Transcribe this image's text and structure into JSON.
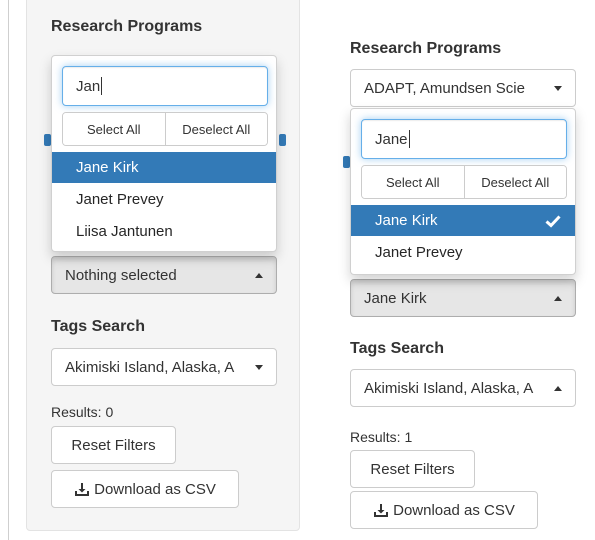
{
  "left_panel": {
    "research_programs_label": "Research Programs",
    "search_value": "Jan",
    "select_all_label": "Select All",
    "deselect_all_label": "Deselect All",
    "options": [
      {
        "label": "Jane Kirk",
        "active": true
      },
      {
        "label": "Janet Prevey",
        "active": false
      },
      {
        "label": "Liisa Jantunen",
        "active": false
      }
    ],
    "person_select_value": "Nothing selected",
    "tags_label": "Tags Search",
    "tags_value": "Akimiski Island, Alaska, A",
    "results_text": "Results: 0",
    "reset_label": "Reset Filters",
    "download_label": "Download as CSV"
  },
  "right_panel": {
    "research_programs_label": "Research Programs",
    "programs_value": "ADAPT, Amundsen Scie",
    "search_value": "Jane",
    "select_all_label": "Select All",
    "deselect_all_label": "Deselect All",
    "options": [
      {
        "label": "Jane Kirk",
        "active": true,
        "checked": true
      },
      {
        "label": "Janet Prevey",
        "active": false,
        "checked": false
      }
    ],
    "person_select_value": "Jane Kirk",
    "tags_label": "Tags Search",
    "tags_value": "Akimiski Island, Alaska, A",
    "results_text": "Results: 1",
    "reset_label": "Reset Filters",
    "download_label": "Download as CSV"
  },
  "icons": [
    "download-icon",
    "check-icon",
    "caret-down-icon",
    "caret-up-icon"
  ],
  "colors": {
    "active": "#337ab7",
    "focus": "#66afe9",
    "panel_bg": "#f5f5f5"
  }
}
